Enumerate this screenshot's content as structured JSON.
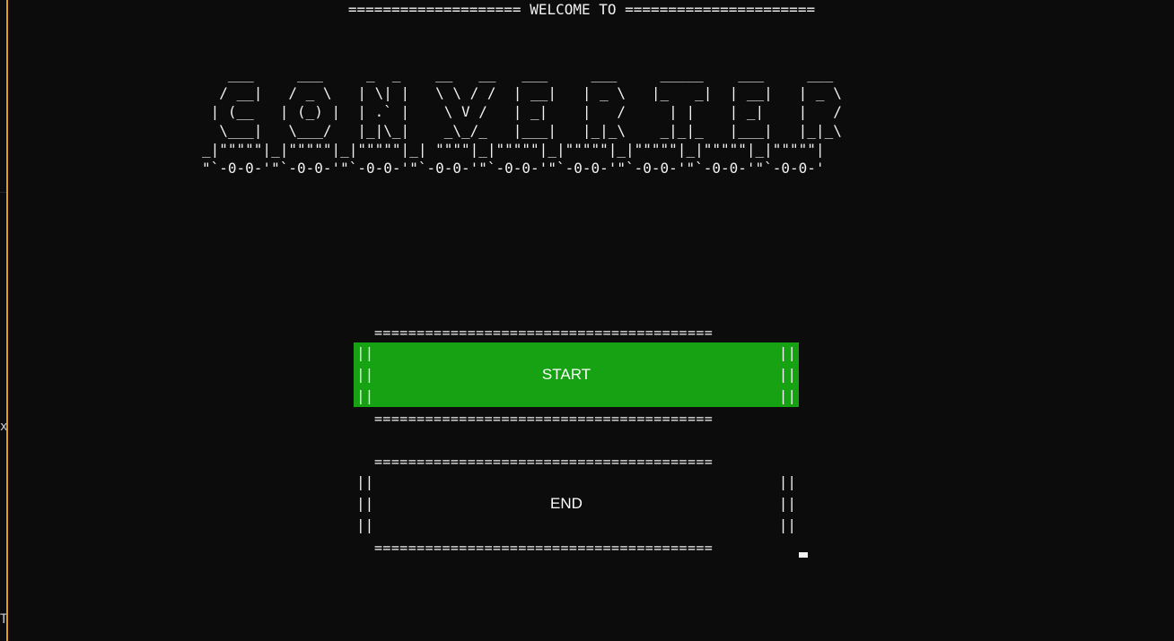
{
  "header": {
    "welcome_line": "==================== WELCOME TO ======================"
  },
  "banner": {
    "title_word": "CONVERTER",
    "ascii_art": "   ___     ___     _  _    __   __   ___     ___     _____    ___     ___   \n  / __|   / _ \\   | \\| |   \\ \\ / /  | __|   | _ \\   |_   _|  | __|   | _ \\  \n | (__   | (_) |  | .` |    \\ V /   | _|    |   /     | |    | _|    |   /  \n  \\___|   \\___/   |_|\\_|    _\\_/_   |___|   |_|_\\    _|_|_   |___|   |_|_\\  \n_|\"\"\"\"\"|_|\"\"\"\"\"|_|\"\"\"\"\"|_| \"\"\"\"|_|\"\"\"\"\"|_|\"\"\"\"\"|_|\"\"\"\"\"|_|\"\"\"\"\"|_|\"\"\"\"\"| \n\"`-0-0-'\"`-0-0-'\"`-0-0-'\"`-0-0-'\"`-0-0-'\"`-0-0-'\"`-0-0-'\"`-0-0-'\"`-0-0-' "
  },
  "menu": {
    "rule": "========================================",
    "pipes": "||\n||\n||",
    "start_label": "START",
    "end_label": "END",
    "selected": "START"
  },
  "gutter": {
    "mark_1": "x",
    "mark_2": "T"
  },
  "colors": {
    "background": "#0c0c0c",
    "text": "#f2f2f2",
    "selected_bg": "#16a213",
    "window_border": "#e39b1f"
  }
}
